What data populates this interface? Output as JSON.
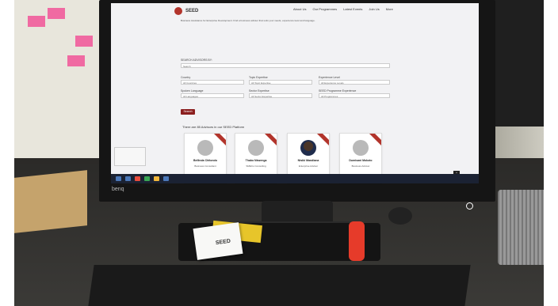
{
  "site": {
    "logo": "SEED",
    "nav": [
      "About Us",
      "Our Programmes",
      "Latest Events",
      "Join Us",
      "More"
    ],
    "intro": "Business Assistance for Enterprise Development. Find a business adviser that suits your needs, experience level and language.",
    "search_label": "SEARCH ADVISORS BY:",
    "search_placeholder": "Search",
    "filters": [
      {
        "label": "Country",
        "value": "All Countries"
      },
      {
        "label": "Topic Expertise",
        "value": "All Topic Expertise"
      },
      {
        "label": "Experience Level",
        "value": "All Experience Levels"
      },
      {
        "label": "Spoken Language",
        "value": "All Languages"
      },
      {
        "label": "Sector Expertise",
        "value": "All Sector Expertise"
      },
      {
        "label": "SEED Programme Experience",
        "value": "All Programmes"
      }
    ],
    "search_button": "Search",
    "cards_title": "There are 85 Advisors in our SEED Platform",
    "cards": [
      {
        "name": "Bellinda Chitondo",
        "role": "Business Consultant"
      },
      {
        "name": "Thabo Nkwenga",
        "role": "SMECo Consulting"
      },
      {
        "name": "Ntsiki Mandlana",
        "role": "Enterprise Advisor"
      },
      {
        "name": "Dumisani Mokoto",
        "role": "Business Advisor"
      }
    ],
    "scroll_top": "^"
  },
  "monitor_brand": "benq",
  "desk_card": "SEED"
}
